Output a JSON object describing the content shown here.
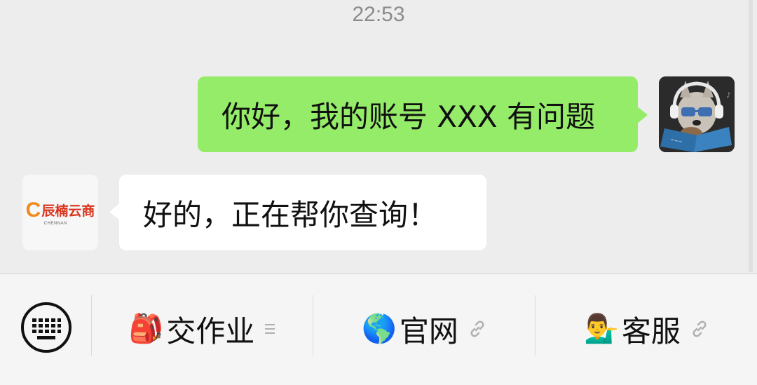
{
  "chat": {
    "timestamp": "22:53",
    "messages": [
      {
        "direction": "outgoing",
        "text": "你好，我的账号 XXX 有问题"
      },
      {
        "direction": "incoming",
        "text": "好的，正在帮你查询！"
      }
    ],
    "bot_avatar": {
      "logo_text": "辰楠云商",
      "logo_sub": "CHENNAN"
    }
  },
  "menu": {
    "items": [
      {
        "emoji": "🎒",
        "label": "交作业",
        "suffix": "submenu-icon"
      },
      {
        "emoji": "🌎",
        "label": "官网",
        "suffix": "link-icon"
      },
      {
        "emoji": "💁‍♂️",
        "label": "客服",
        "suffix": "link-icon"
      }
    ]
  },
  "colors": {
    "outgoing_bubble": "#95ec69",
    "incoming_bubble": "#ffffff",
    "chat_background": "#ededed",
    "logo_orange": "#f08a1c",
    "logo_red": "#d9341c"
  }
}
